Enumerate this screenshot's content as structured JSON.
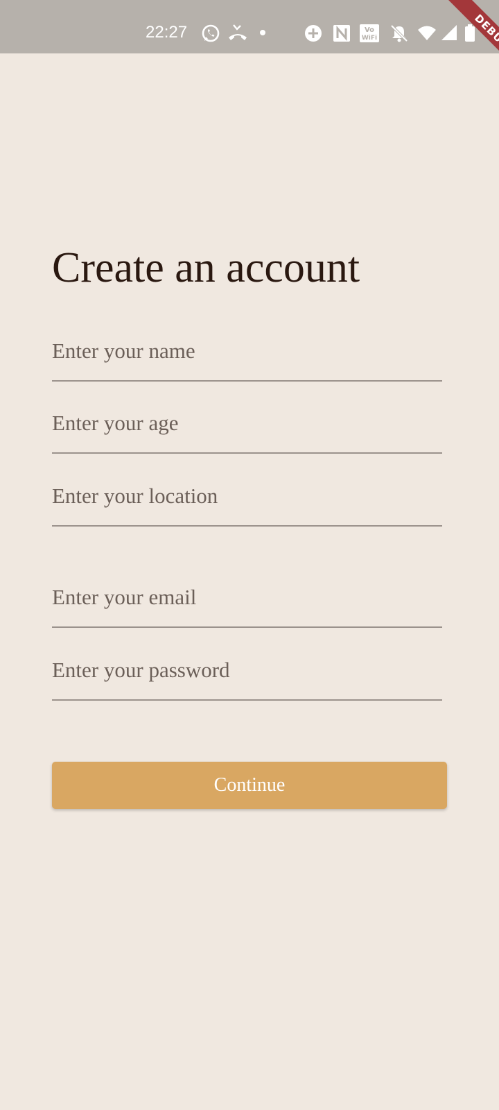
{
  "status_bar": {
    "time": "22:27",
    "icons": [
      "whatsapp-icon",
      "missed-call-icon",
      "dot-icon",
      "data-saver-icon",
      "nfc-icon",
      "vowifi-icon",
      "mute-icon",
      "wifi-icon",
      "signal-icon",
      "battery-icon"
    ],
    "vowifi_text_top": "Vo",
    "vowifi_text_bottom": "WiFi"
  },
  "debug_banner": {
    "label": "DEBUG"
  },
  "form": {
    "title": "Create an account",
    "fields": [
      {
        "name": "name",
        "placeholder": "Enter your name",
        "value": ""
      },
      {
        "name": "age",
        "placeholder": "Enter your age",
        "value": ""
      },
      {
        "name": "location",
        "placeholder": "Enter your location",
        "value": ""
      },
      {
        "name": "email",
        "placeholder": "Enter your email",
        "value": ""
      },
      {
        "name": "password",
        "placeholder": "Enter your password",
        "value": ""
      }
    ],
    "continue_label": "Continue"
  },
  "colors": {
    "background": "#f0e8e0",
    "status_bar": "#b6b1ab",
    "heading_text": "#2a1810",
    "placeholder_text": "#6b5f58",
    "underline": "#9b928c",
    "button": "#d9a762",
    "button_text": "#ffffff",
    "debug_banner": "#a3373a"
  }
}
